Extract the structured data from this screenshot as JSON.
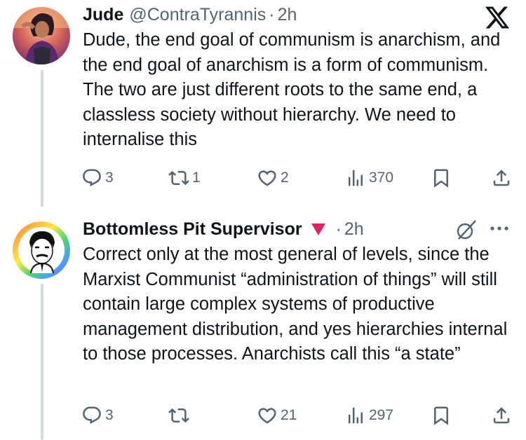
{
  "app": {
    "logo_icon": "x-logo-icon"
  },
  "tweets": [
    {
      "name": "Jude",
      "handle": "@ContraTyrannis",
      "separator": "·",
      "time": "2h",
      "text": "Dude, the end goal of communism is anarchism, and the end goal of anarchism is a form of communism. The two are just different roots to the same end, a classless society without hierarchy. We need to internalise this",
      "actions": {
        "replies": "3",
        "reposts": "1",
        "likes": "2",
        "views": "370"
      }
    },
    {
      "name": "Bottomless Pit Supervisor",
      "badge_icon": "red-triangle-icon",
      "separator": "·",
      "time": "2h",
      "text": "Correct only at the most general of levels, since the Marxist Communist “administration of things” will still contain large complex systems of productive management distribution, and yes hierarchies internal to those processes. Anarchists call this “a state”",
      "actions": {
        "replies": "3",
        "reposts": "",
        "likes": "21",
        "views": "297"
      }
    }
  ],
  "colors": {
    "text": "#0f1419",
    "secondary": "#536471",
    "thread_line": "#cfd9de",
    "badge_red": "#e0245e"
  }
}
